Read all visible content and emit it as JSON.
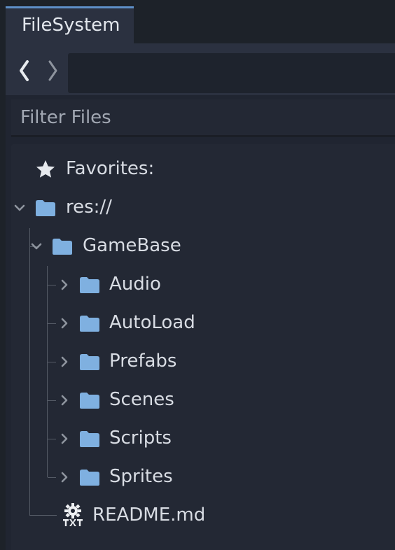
{
  "window": {
    "tab_label": "FileSystem"
  },
  "nav": {
    "back_icon": "chevron-left-icon",
    "forward_icon": "chevron-right-icon",
    "path_value": ""
  },
  "filter": {
    "placeholder": "Filter Files"
  },
  "tree": {
    "favorites_label": "Favorites:",
    "root_label": "res://",
    "gamebase_label": "GameBase",
    "children": [
      {
        "label": "Audio"
      },
      {
        "label": "AutoLoad"
      },
      {
        "label": "Prefabs"
      },
      {
        "label": "Scenes"
      },
      {
        "label": "Scripts"
      },
      {
        "label": "Sprites"
      }
    ],
    "readme_label": "README.md"
  },
  "colors": {
    "folder": "#7fb0e0",
    "accent": "#5e8fc7",
    "text": "#d8dce3"
  }
}
